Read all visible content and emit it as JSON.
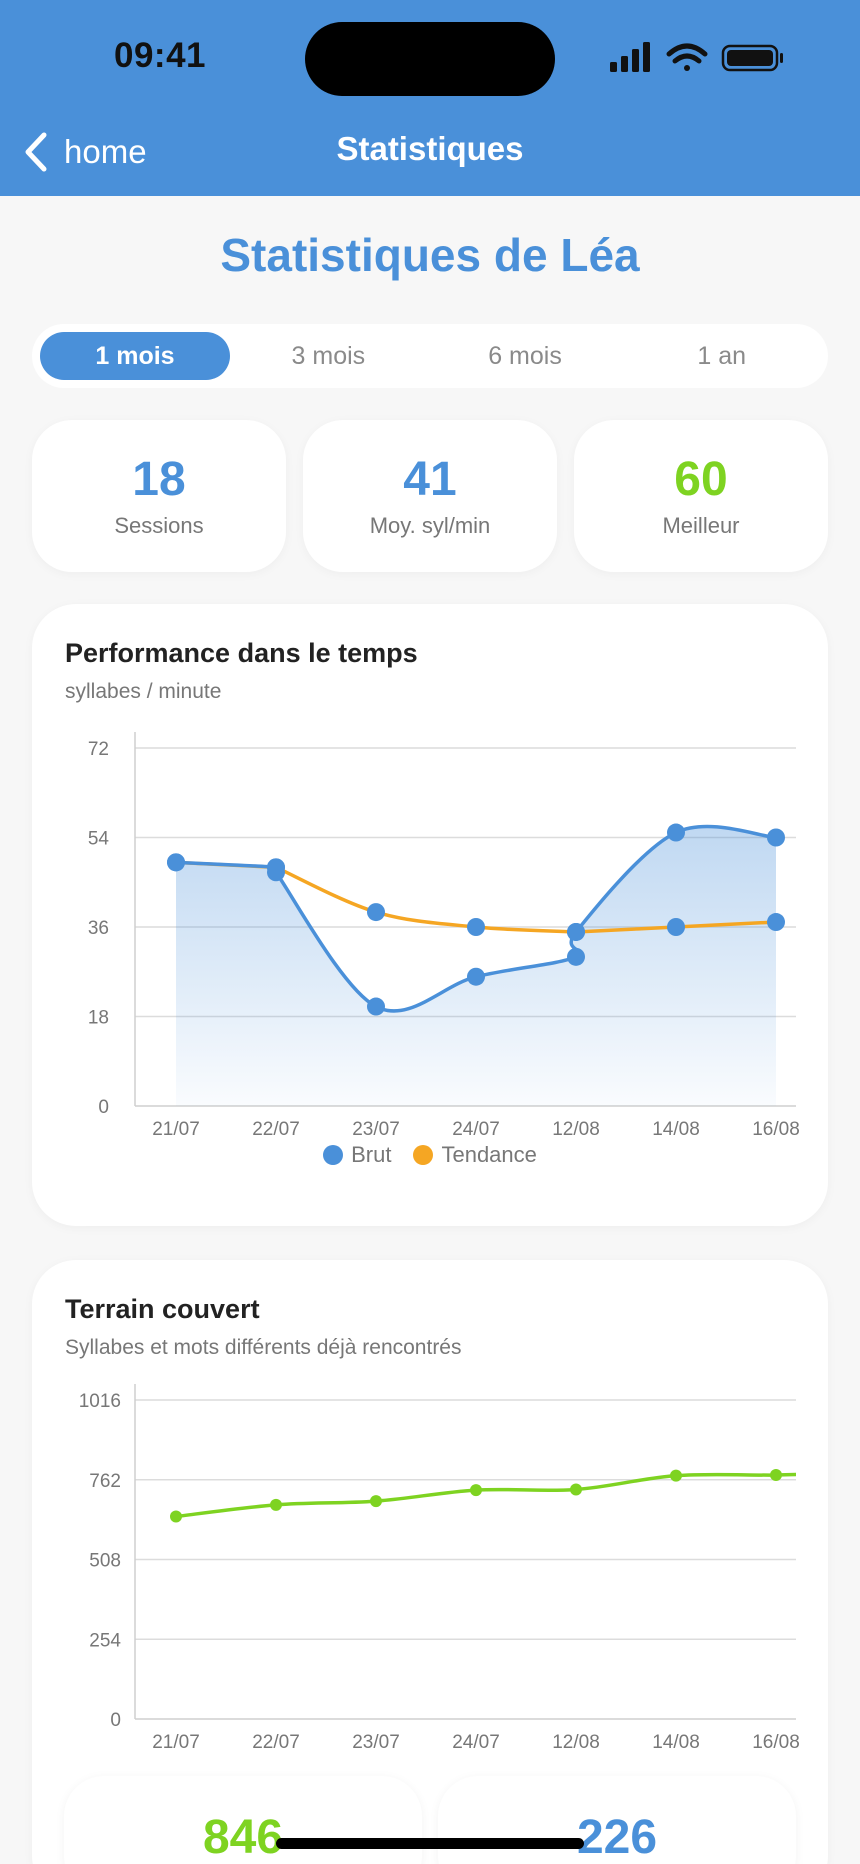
{
  "status_bar": {
    "time": "09:41"
  },
  "nav": {
    "back_label": "home",
    "title": "Statistiques"
  },
  "page_title": "Statistiques de Léa",
  "periods": [
    "1 mois",
    "3 mois",
    "6 mois",
    "1 an"
  ],
  "selected_period": "1 mois",
  "stats": [
    {
      "value": "18",
      "label": "Sessions",
      "color": "#4a90d9"
    },
    {
      "value": "41",
      "label": "Moy. syl/min",
      "color": "#4a90d9"
    },
    {
      "value": "60",
      "label": "Meilleur",
      "color": "#7ed321"
    }
  ],
  "colors": {
    "primary": "#4a90d9",
    "trend": "#f5a623",
    "green": "#7ed321"
  },
  "performance": {
    "title": "Performance dans le temps",
    "subtitle": "syllabes / minute",
    "legend": [
      "Brut",
      "Tendance"
    ]
  },
  "coverage": {
    "title": "Terrain couvert",
    "subtitle": "Syllabes et mots différents déjà rencontrés"
  },
  "bottom_stats": [
    {
      "value": "846",
      "color": "#7ed321"
    },
    {
      "value": "226",
      "color": "#4a90d9"
    }
  ],
  "chart_data": [
    {
      "type": "line",
      "x": [
        "21/07",
        "22/07",
        "22/07",
        "23/07",
        "24/07",
        "12/08",
        "12/08",
        "14/08",
        "16/08"
      ],
      "xtick_labels": [
        "21/07",
        "22/07",
        "23/07",
        "24/07",
        "12/08",
        "14/08",
        "16/08"
      ],
      "series": [
        {
          "name": "Brut",
          "values": [
            49,
            48,
            47,
            20,
            26,
            30,
            35,
            55,
            54
          ]
        },
        {
          "name": "Tendance",
          "values": [
            49,
            48,
            48,
            39,
            36,
            35,
            35,
            36,
            37
          ]
        }
      ],
      "ylim": [
        0,
        72
      ],
      "yticks": [
        0,
        18,
        36,
        54,
        72
      ],
      "grid": true,
      "legend": "bottom-center"
    },
    {
      "type": "line",
      "x": [
        "21/07",
        "22/07",
        "23/07",
        "24/07",
        "12/08",
        "14/08",
        "16/08"
      ],
      "series": [
        {
          "values": [
            645,
            682,
            694,
            729,
            731,
            775,
            777
          ]
        }
      ],
      "ylim": [
        0,
        1016
      ],
      "yticks": [
        0,
        254,
        508,
        762,
        1016
      ],
      "grid": true
    }
  ]
}
